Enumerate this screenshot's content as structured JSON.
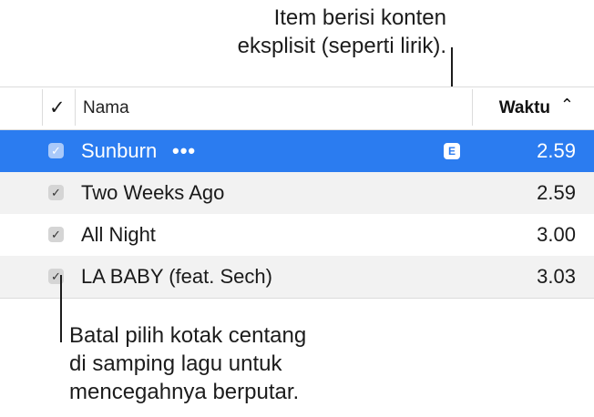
{
  "callouts": {
    "explicit_line1": "Item berisi konten",
    "explicit_line2": "eksplisit (seperti lirik).",
    "checkbox_line1": "Batal pilih kotak centang",
    "checkbox_line2": "di samping lagu untuk",
    "checkbox_line3": "mencegahnya berputar."
  },
  "header": {
    "check_icon": "✓",
    "name_label": "Nama",
    "time_label": "Waktu",
    "sort_icon": "chevron-up-icon"
  },
  "rows": [
    {
      "title": "Sunburn",
      "more": "•••",
      "explicit_badge": "E",
      "time": "2.59",
      "checked": true,
      "selected": true
    },
    {
      "title": "Two Weeks Ago",
      "time": "2.59",
      "checked": true,
      "selected": false
    },
    {
      "title": "All Night",
      "time": "3.00",
      "checked": true,
      "selected": false
    },
    {
      "title": "LA BABY (feat. Sech)",
      "time": "3.03",
      "checked": true,
      "selected": false
    }
  ],
  "colors": {
    "selection": "#2b7cf0",
    "alt_row": "#f2f2f2"
  }
}
